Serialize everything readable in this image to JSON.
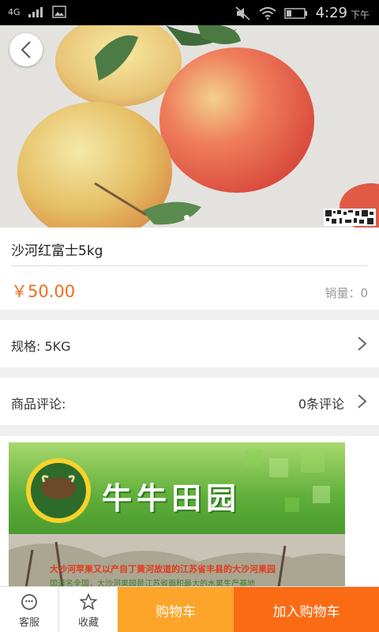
{
  "status_bar": {
    "network": "4G",
    "time": "4:29",
    "ampm": "下午"
  },
  "product": {
    "title": "沙河红富士5kg",
    "price": "￥50.00",
    "sales": "销量：0"
  },
  "spec": {
    "label": "规格: 5KG"
  },
  "reviews": {
    "label": "商品评论:",
    "count": "0条评论"
  },
  "detail_banner": {
    "brand": "牛牛田园",
    "caption": "大沙河苹果又以产自丁黄河故道的江苏省丰县的大沙河果园",
    "caption2": "国道名全国，大沙河果园是江苏省面积最大的水果生产基地"
  },
  "bottom_bar": {
    "service_label": "客服",
    "favorite_label": "收藏",
    "cart_label": "购物车",
    "add_to_cart_label": "加入购物车"
  },
  "colors": {
    "price": "#f06d1e",
    "cart_button": "#fda42a",
    "add_button": "#fb6b14"
  }
}
